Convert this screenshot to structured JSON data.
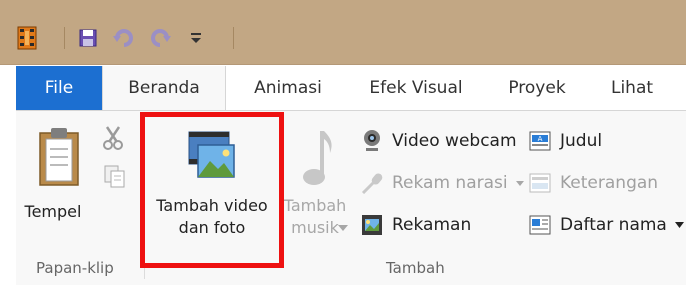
{
  "tabs": [
    {
      "label": "File"
    },
    {
      "label": "Beranda"
    },
    {
      "label": "Animasi"
    },
    {
      "label": "Efek Visual"
    },
    {
      "label": "Proyek"
    },
    {
      "label": "Lihat"
    }
  ],
  "clipboard": {
    "paste_label": "Tempel",
    "group_label": "Papan-klip"
  },
  "add": {
    "add_video_photo_label": "Tambah video dan foto",
    "add_music_label": "Tambah musik",
    "video_webcam_label": "Video webcam",
    "record_narration_label": "Rekam narasi",
    "snapshot_label": "Rekaman",
    "title_label": "Judul",
    "caption_label": "Keterangan",
    "credits_label": "Daftar nama",
    "group_label": "Tambah"
  },
  "colors": {
    "title_bar": "#c2a784",
    "file_tab": "#1c6fd1",
    "highlight": "#ee1111"
  }
}
